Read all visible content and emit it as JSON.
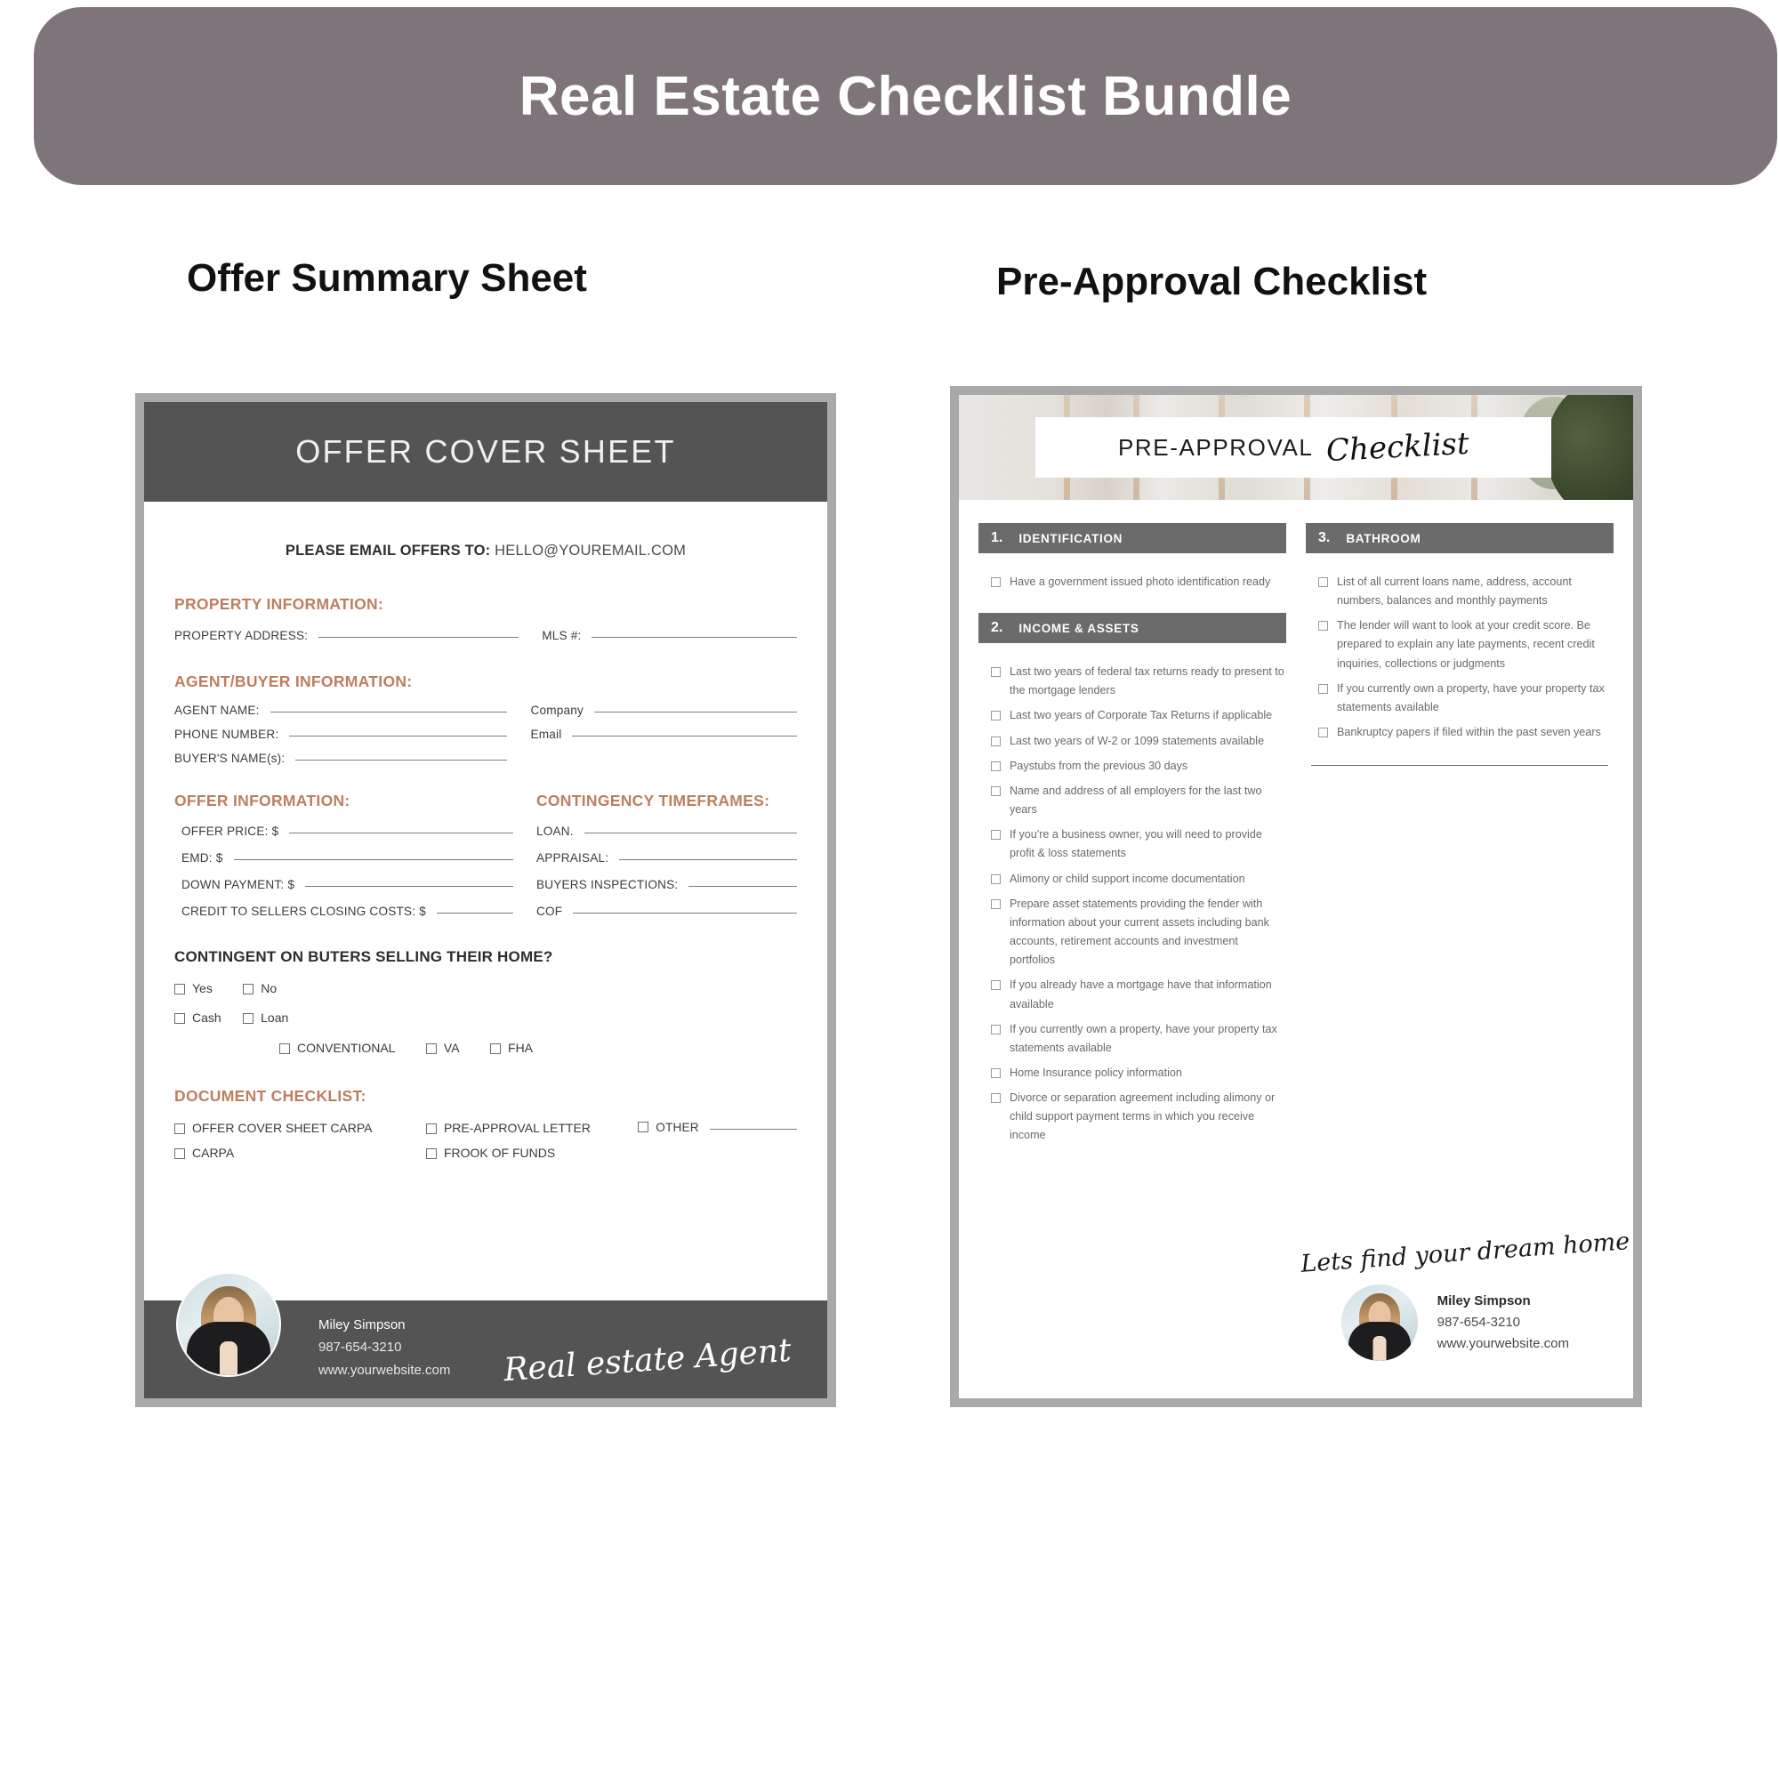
{
  "banner": {
    "title": "Real Estate Checklist Bundle",
    "color": "#7f747a"
  },
  "headings": {
    "left": "Offer Summary Sheet",
    "right": "Pre-Approval Checklist"
  },
  "offer_sheet": {
    "header_title": "OFFER COVER SHEET",
    "email_label": "PLEASE EMAIL OFFERS TO:",
    "email_value": "HELLO@YOUREMAIL.COM",
    "property_section": "PROPERTY INFORMATION:",
    "property_address_label": "PROPERTY ADDRESS:",
    "mls_label": "MLS #:",
    "agent_section": "AGENT/BUYER INFORMATION:",
    "agent_name_label": "AGENT NAME:",
    "phone_label": "PHONE NUMBER:",
    "buyers_name_label": "BUYER'S NAME(s):",
    "company_label": "Company",
    "email_field_label": "Email",
    "offer_section": "OFFER INFORMATION:",
    "offer_price_label": "OFFER PRICE: $",
    "emd_label": "EMD: $",
    "down_payment_label": "DOWN PAYMENT: $",
    "credit_label": "CREDIT TO SELLERS CLOSING COSTS: $",
    "contingency_section": "CONTINGENCY TIMEFRAMES:",
    "loan_label": "LOAN.",
    "appraisal_label": "APPRAISAL:",
    "buyers_inspections_label": "BUYERS INSPECTIONS:",
    "cof_label": "COF",
    "contingent_question": "CONTINGENT ON BUTERS SELLING THEIR HOME?",
    "yesno": [
      "Yes",
      "No"
    ],
    "cashloan": [
      "Cash",
      "Loan"
    ],
    "loan_types": [
      "CONVENTIONAL",
      "VA",
      "FHA"
    ],
    "document_section": "DOCUMENT CHECKLIST:",
    "doc_col1": [
      "OFFER COVER SHEET CARPA",
      "CARPA"
    ],
    "doc_col2": [
      "PRE-APPROVAL LETTER",
      "FROOK OF FUNDS"
    ],
    "doc_col3": [
      "OTHER"
    ],
    "footer": {
      "name": "Miley Simpson",
      "phone": "987-654-3210",
      "website": "www.yourwebsite.com",
      "script": "Real estate Agent"
    },
    "accent_color": "#bd7e5e",
    "header_color": "#545454"
  },
  "pre_approval": {
    "hero_title_plain": "PRE-APPROVAL",
    "hero_title_script": "Checklist",
    "sections": [
      {
        "number": "1.",
        "name": "IDENTIFICATION",
        "items": [
          "Have a government issued photo identification ready"
        ]
      },
      {
        "number": "2.",
        "name": "INCOME & ASSETS",
        "items": [
          "Last two years of federal tax returns ready to present to the mortgage lenders",
          "Last two years of Corporate Tax Returns if applicable",
          "Last two years of W-2 or 1099 statements available",
          "Paystubs from the previous 30 days",
          "Name and address of all employers for the last two years",
          "If you're a business owner, you will need to provide profit & loss statements",
          "Alimony or child support income documentation",
          "Prepare asset statements providing the fender with information about your current assets including bank accounts, retirement accounts and investment portfolios",
          "If you already have a mortgage have that information available",
          "If you currently own a property, have your property tax statements available",
          "Home Insurance policy information",
          "Divorce or separation agreement including alimony or child support payment terms in which you receive income"
        ]
      },
      {
        "number": "3.",
        "name": "BATHROOM",
        "items": [
          "List of all current loans name, address, account numbers, balances and monthly payments",
          "The lender will want to look at your credit score. Be prepared to explain any late payments, recent credit inquiries, collections or judgments",
          "If you currently own a property, have your property tax statements available",
          "Bankruptcy papers if filed within the past seven years"
        ]
      }
    ],
    "script_tagline": "Lets find your dream home",
    "footer": {
      "name": "Miley Simpson",
      "phone": "987-654-3210",
      "website": "www.yourwebsite.com"
    },
    "section_bar_color": "#6b6b6b"
  }
}
